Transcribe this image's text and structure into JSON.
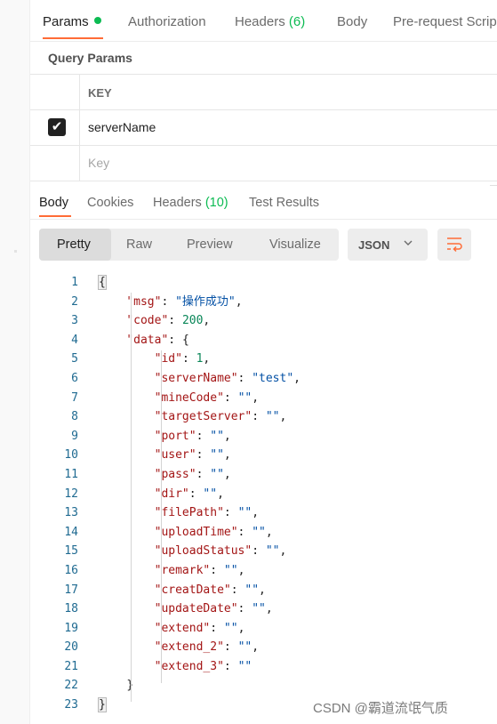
{
  "request_tabs": [
    {
      "label": "Params",
      "active": true,
      "indicator": true
    },
    {
      "label": "Authorization"
    },
    {
      "label": "Headers ",
      "count": "(6)"
    },
    {
      "label": "Body"
    },
    {
      "label": "Pre-request Scrip"
    }
  ],
  "query_params": {
    "title": "Query Params",
    "column_key": "KEY",
    "rows": [
      {
        "checked": true,
        "key": "serverName"
      }
    ],
    "new_row_placeholder": "Key"
  },
  "response_tabs": [
    {
      "label": "Body",
      "active": true
    },
    {
      "label": "Cookies"
    },
    {
      "label": "Headers ",
      "count": "(10)"
    },
    {
      "label": "Test Results"
    }
  ],
  "view_modes": [
    "Pretty",
    "Raw",
    "Preview",
    "Visualize"
  ],
  "active_view_mode": "Pretty",
  "format": "JSON",
  "icons": {
    "checkbox": "check-icon",
    "dropdown": "chevron-down-icon",
    "wrap": "wrap-lines-icon"
  },
  "colors": {
    "accent": "#ff6c37",
    "indicator": "#0cbb52",
    "key": "#a31515",
    "string": "#0451a5",
    "number": "#098658"
  },
  "code_lines": [
    {
      "n": "1",
      "t": "{"
    },
    {
      "n": "2",
      "t": "    \"msg\": \"操作成功\","
    },
    {
      "n": "3",
      "t": "    \"code\": 200,"
    },
    {
      "n": "4",
      "t": "    \"data\": {"
    },
    {
      "n": "5",
      "t": "        \"id\": 1,"
    },
    {
      "n": "6",
      "t": "        \"serverName\": \"test\","
    },
    {
      "n": "7",
      "t": "        \"mineCode\": \"\","
    },
    {
      "n": "8",
      "t": "        \"targetServer\": \"\","
    },
    {
      "n": "9",
      "t": "        \"port\": \"\","
    },
    {
      "n": "10",
      "t": "        \"user\": \"\","
    },
    {
      "n": "11",
      "t": "        \"pass\": \"\","
    },
    {
      "n": "12",
      "t": "        \"dir\": \"\","
    },
    {
      "n": "13",
      "t": "        \"filePath\": \"\","
    },
    {
      "n": "14",
      "t": "        \"uploadTime\": \"\","
    },
    {
      "n": "15",
      "t": "        \"uploadStatus\": \"\","
    },
    {
      "n": "16",
      "t": "        \"remark\": \"\","
    },
    {
      "n": "17",
      "t": "        \"creatDate\": \"\","
    },
    {
      "n": "18",
      "t": "        \"updateDate\": \"\","
    },
    {
      "n": "19",
      "t": "        \"extend\": \"\","
    },
    {
      "n": "20",
      "t": "        \"extend_2\": \"\","
    },
    {
      "n": "21",
      "t": "        \"extend_3\": \"\""
    },
    {
      "n": "22",
      "t": "    }"
    },
    {
      "n": "23",
      "t": "}"
    }
  ],
  "watermark": "CSDN @霸道流氓气质"
}
